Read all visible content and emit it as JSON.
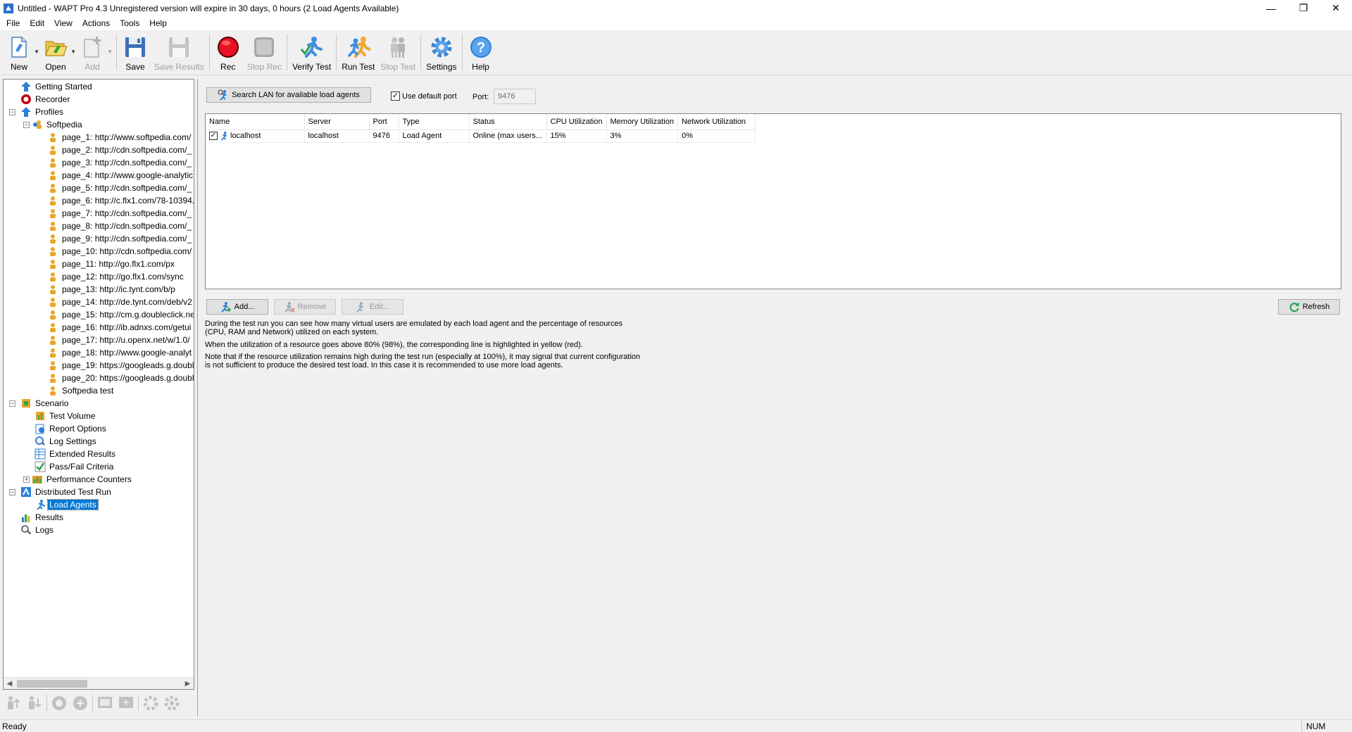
{
  "window": {
    "title": "Untitled - WAPT Pro 4.3  Unregistered version will expire in 30 days, 0 hours (2 Load Agents Available)",
    "controls": [
      "—",
      "❐",
      "✕"
    ]
  },
  "menu": [
    "File",
    "Edit",
    "View",
    "Actions",
    "Tools",
    "Help"
  ],
  "toolbar": {
    "new": "New",
    "open": "Open",
    "add": "Add",
    "save": "Save",
    "save_results": "Save Results",
    "rec": "Rec",
    "stop_rec": "Stop Rec",
    "verify_test": "Verify Test",
    "run_test": "Run Test",
    "stop_test": "Stop Test",
    "settings": "Settings",
    "help": "Help"
  },
  "tree": {
    "getting_started": "Getting Started",
    "recorder": "Recorder",
    "profiles": "Profiles",
    "softpedia": "Softpedia",
    "pages": [
      "page_1: http://www.softpedia.com/",
      "page_2: http://cdn.softpedia.com/_",
      "page_3: http://cdn.softpedia.com/_",
      "page_4: http://www.google-analytic",
      "page_5: http://cdn.softpedia.com/_",
      "page_6: http://c.flx1.com/78-10394.",
      "page_7: http://cdn.softpedia.com/_",
      "page_8: http://cdn.softpedia.com/_",
      "page_9: http://cdn.softpedia.com/_",
      "page_10: http://cdn.softpedia.com/",
      "page_11: http://go.flx1.com/px",
      "page_12: http://go.flx1.com/sync",
      "page_13: http://ic.tynt.com/b/p",
      "page_14: http://de.tynt.com/deb/v2",
      "page_15: http://cm.g.doubleclick.ne",
      "page_16: http://ib.adnxs.com/getui",
      "page_17: http://u.openx.net/w/1.0/",
      "page_18: http://www.google-analyt",
      "page_19: https://googleads.g.doubl",
      "page_20: https://googleads.g.doubl"
    ],
    "softpedia_test": "Softpedia test",
    "scenario": "Scenario",
    "test_volume": "Test Volume",
    "report_options": "Report Options",
    "log_settings": "Log Settings",
    "extended_results": "Extended Results",
    "pass_fail": "Pass/Fail Criteria",
    "perf_counters": "Performance Counters",
    "distributed": "Distributed Test Run",
    "load_agents": "Load Agents",
    "results": "Results",
    "logs": "Logs"
  },
  "agents": {
    "search_button": "Search LAN for available load agents",
    "use_default_port": "Use default port",
    "use_default_port_checked": true,
    "port_label": "Port:",
    "port_value": "9476",
    "columns": [
      "Name",
      "Server",
      "Port",
      "Type",
      "Status",
      "CPU Utilization",
      "Memory Utilization",
      "Network Utilization"
    ],
    "rows": [
      {
        "checked": true,
        "name": "localhost",
        "server": "localhost",
        "port": "9476",
        "type": "Load Agent",
        "status": "Online (max users...",
        "cpu": "15%",
        "memory": "3%",
        "network": "0%"
      }
    ],
    "add_button": "Add...",
    "remove_button": "Remove",
    "edit_button": "Edit...",
    "refresh_button": "Refresh",
    "info1": "During the test run you can see how many virtual users are emulated by each load agent and the percentage of resources (CPU, RAM and Network) utilized on each system.",
    "info2": "When the utilization of a resource goes above 80% (98%), the corresponding line is highlighted in yellow (red).",
    "info3": "Note that if the resource utilization remains high during the test run (especially at 100%), it may signal that current configuration is not sufficient to produce the desired test load. In this case it is recommended to use more load agents."
  },
  "status": {
    "text": "Ready",
    "num": "NUM"
  },
  "colors": {
    "selection": "#0078d7",
    "rec_red": "#e81123",
    "accent_blue": "#1e88e5"
  }
}
